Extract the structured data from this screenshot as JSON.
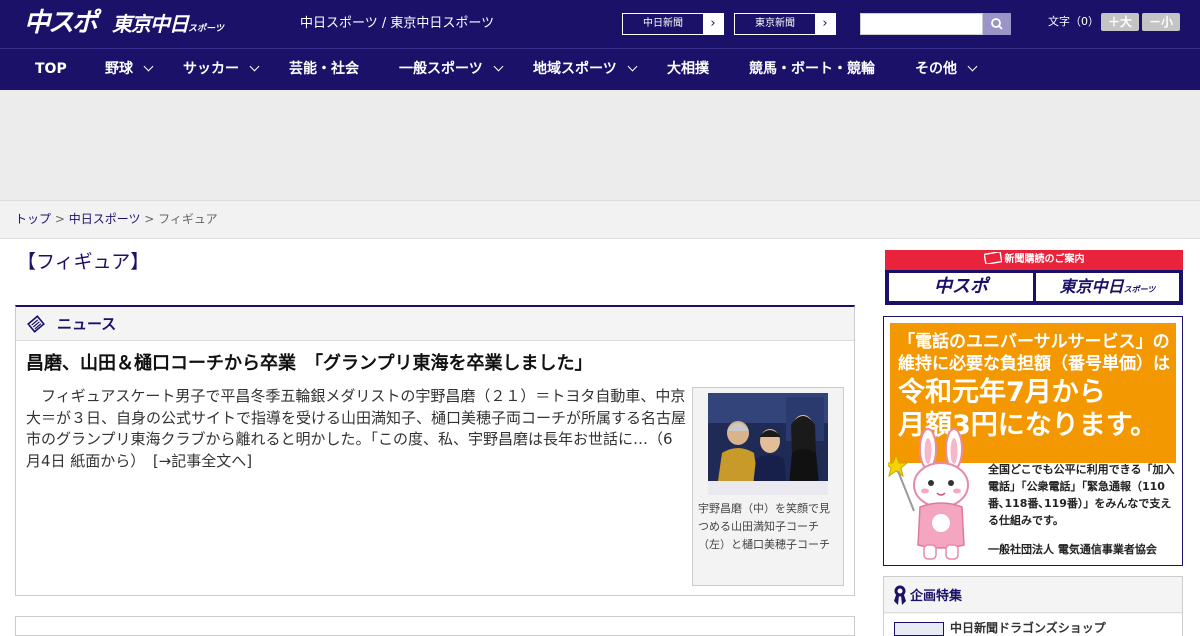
{
  "header": {
    "logo_main": "中スポ",
    "logo_tokyo": "東京中日",
    "logo_tokyo_small": "スポーツ",
    "site_name": "中日スポーツ / 東京中日スポーツ",
    "ext_links": [
      {
        "label": "中日新聞"
      },
      {
        "label": "東京新聞"
      }
    ],
    "search": {
      "placeholder": ""
    },
    "font_size_label": "文字（0）",
    "font_bigger": "＋大",
    "font_smaller": "－小"
  },
  "nav": {
    "items": [
      {
        "label": "TOP"
      },
      {
        "label": "野球"
      },
      {
        "label": "サッカー"
      },
      {
        "label": "芸能・社会"
      },
      {
        "label": "一般スポーツ"
      },
      {
        "label": "地域スポーツ"
      },
      {
        "label": "大相撲"
      },
      {
        "label": "競馬・ボート・競輪"
      },
      {
        "label": "その他"
      }
    ]
  },
  "breadcrumb": {
    "items": [
      {
        "label": "トップ"
      },
      {
        "label": "中日スポーツ"
      },
      {
        "label": "フィギュア"
      }
    ],
    "separator": " > "
  },
  "page_title": "【フィギュア】",
  "news": {
    "section_label": "ニュース",
    "headline": "昌磨、山田＆樋口コーチから卒業　「グランプリ東海を卒業しました」",
    "body": "フィギュアスケート男子で平昌冬季五輪銀メダリストの宇野昌磨（２１）＝トヨタ自動車、中京大＝が３日、自身の公式サイトで指導を受ける山田満知子、樋口美穂子両コーチが所属する名古屋市のグランプリ東海クラブから離れると明かした。「この度、私、宇野昌磨は長年お世話に…（6月4日 紙面から）",
    "more_link": "[→記事全文へ]",
    "photo_caption": "宇野昌磨（中）を笑顔で見つめる山田満知子コーチ（左）と樋口美穂子コーチ"
  },
  "sidebar": {
    "subscription": {
      "title": "新聞購読のご案内",
      "logo_left": "中スポ",
      "logo_right": "東京中日",
      "logo_right_small": "スポーツ"
    },
    "universal_ad": {
      "line1": "「電話のユニバーサルサービス」の",
      "line2": "維持に必要な負担額（番号単価）は",
      "big1": "令和元年7月から",
      "big2": "月額3円になります。",
      "body": "全国どこでも公平に利用できる「加入電話」「公衆電話」「緊急通報（110番､118番､119番）」をみんなで支える仕組みです。",
      "org": "一般社団法人 電気通信事業者協会"
    },
    "kikaku": {
      "title": "企画特集",
      "item": "中日新聞ドラゴンズショップ"
    }
  },
  "colors": {
    "brand_navy": "#1b1169",
    "accent_red": "#e8233b",
    "ad_orange": "#f39800"
  }
}
